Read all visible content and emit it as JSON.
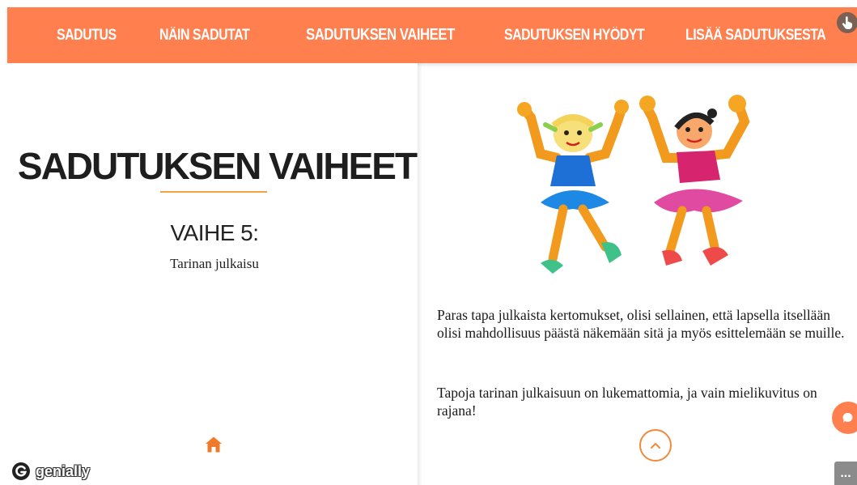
{
  "nav": {
    "items": [
      {
        "label": "SADUTUS"
      },
      {
        "label": "NÄIN SADUTAT"
      },
      {
        "label": "SADUTUKSEN VAIHEET"
      },
      {
        "label": "SADUTUKSEN HYÖDYT"
      },
      {
        "label": "LISÄÄ SADUTUKSESTA"
      }
    ],
    "active_index": 2
  },
  "left": {
    "title": "SADUTUKSEN VAIHEET",
    "step_title": "VAIHE 5:",
    "step_subtitle": "Tarinan julkaisu"
  },
  "right": {
    "paragraph1": "Paras tapa julkaista kertomukset, olisi sellainen, että lapsella itsellään olisi mahdollisuus päästä näkemään sitä ja myös esittelemään se muille.",
    "paragraph2": "Tapoja tarinan julkaisuun on lukemattomia, ja vain mielikuvitus on rajana!"
  },
  "branding": {
    "logo_text": "genially"
  },
  "colors": {
    "accent": "#ff7f4f",
    "underline": "#f0a44a",
    "hand_button": "#7a6055",
    "more_button": "#8b8b8b"
  },
  "icons": {
    "home": "home-icon",
    "up": "chevron-up-icon",
    "chat": "chat-bubble-icon",
    "hand": "hand-pointer-icon",
    "more": "ellipsis-icon"
  },
  "more_label": "..."
}
